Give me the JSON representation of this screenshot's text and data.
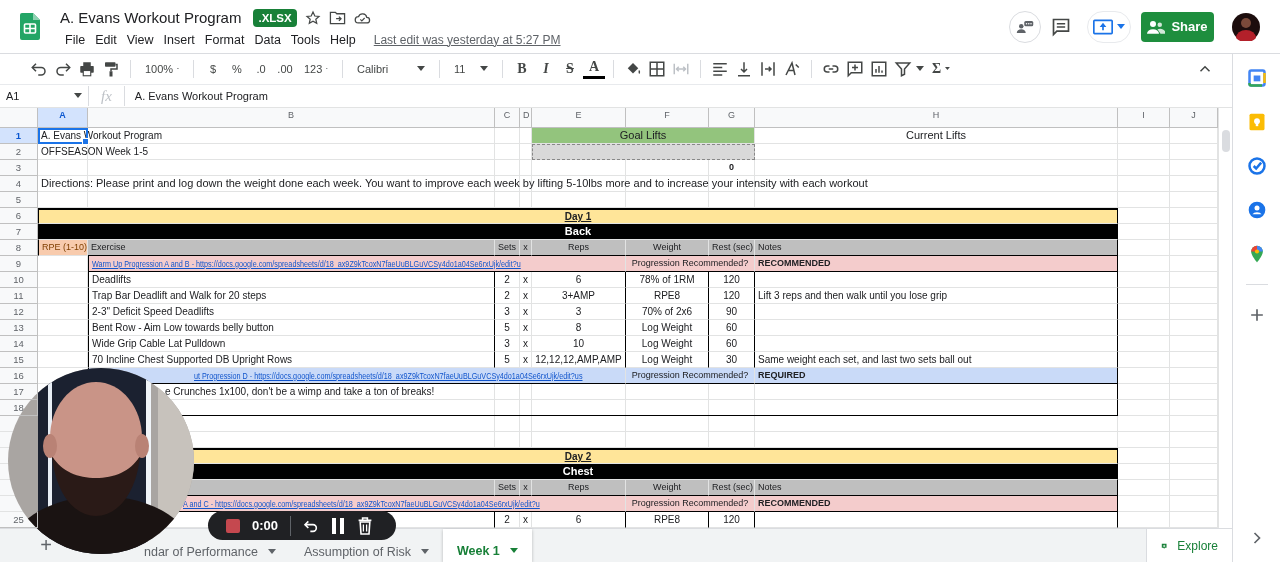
{
  "app": {
    "title": "A. Evans Workout Program",
    "badge": ".XLSX",
    "menu": [
      "File",
      "Edit",
      "View",
      "Insert",
      "Format",
      "Data",
      "Tools",
      "Help"
    ],
    "last_edit": "Last edit was yesterday at 5:27 PM",
    "share": "Share"
  },
  "toolbar": {
    "zoom": "100%",
    "currency": "$",
    "percent": "%",
    "decrease_decimals": ".0",
    "increase_decimals": ".00",
    "more_formats": "123",
    "font": "Calibri",
    "font_size": "11",
    "bold": "B",
    "italic": "I",
    "strikethrough": "S",
    "text_color": "A",
    "functions": "Σ"
  },
  "formula_bar": {
    "cell": "A1",
    "fx": "fx",
    "value": "A. Evans Workout Program"
  },
  "columns": [
    "A",
    "B",
    "C",
    "D",
    "E",
    "F",
    "G",
    "H",
    "I",
    "J"
  ],
  "rows": [
    {
      "number": "1",
      "selected": true,
      "kind": "title",
      "text": "A. Evans Workout Program",
      "goal": "Goal Lifts",
      "current": "Current Lifts"
    },
    {
      "number": "2",
      "selected": false,
      "kind": "subtitle",
      "text": "OFFSEASON Week 1-5"
    },
    {
      "number": "3",
      "selected": false,
      "kind": "total",
      "value": "0"
    },
    {
      "number": "4",
      "selected": false,
      "kind": "directions",
      "text": "Directions: Please print and log down the weight done each week. You want to improve each week by lifting 5-10lbs more and to increase your intensity with each workout"
    },
    {
      "number": "5",
      "selected": false,
      "kind": "blank"
    },
    {
      "number": "6",
      "selected": false,
      "kind": "day",
      "text": "Day 1"
    },
    {
      "number": "7",
      "selected": false,
      "kind": "section",
      "text": "Back"
    },
    {
      "number": "8",
      "selected": false,
      "kind": "header",
      "rpe": "RPE (1-10)",
      "exercise": "Exercise",
      "sets": "Sets",
      "x": "x",
      "reps": "Reps",
      "weight": "Weight",
      "rest": "Rest (sec)",
      "notes": "Notes"
    },
    {
      "number": "9",
      "selected": false,
      "kind": "link",
      "color": "#f4cccc",
      "link": "Warm Up Progression A and B - https://docs.google.com/spreadsheets/d/18_ax9Z9kTcoxN7faeUuBLGuVCSy4do1a04Se6rxUjk/edit?u",
      "question": "Progression Recommended?",
      "requirement": "RECOMMENDED"
    },
    {
      "number": "10",
      "selected": false,
      "kind": "exercise",
      "name": "Deadlifts",
      "sets": "2",
      "x": "x",
      "reps": "6",
      "weight": "78% of 1RM",
      "rest": "120"
    },
    {
      "number": "11",
      "selected": false,
      "kind": "exercise",
      "name": "Trap Bar Deadlift and Walk for 20 steps",
      "sets": "2",
      "x": "x",
      "reps": "3+AMP",
      "weight": "RPE8",
      "rest": "120",
      "notes": "Lift 3 reps and then walk until you lose grip"
    },
    {
      "number": "12",
      "selected": false,
      "kind": "exercise",
      "name": "2-3\" Deficit Speed Deadlifts",
      "sets": "3",
      "x": "x",
      "reps": "3",
      "weight": "70% of 2x6",
      "rest": "90"
    },
    {
      "number": "13",
      "selected": false,
      "kind": "exercise",
      "name": "Bent Row - Aim Low towards belly button",
      "sets": "5",
      "x": "x",
      "reps": "8",
      "weight": "Log Weight",
      "rest": "60"
    },
    {
      "number": "14",
      "selected": false,
      "kind": "exercise",
      "name": "Wide Grip Cable Lat Pulldown",
      "sets": "3",
      "x": "x",
      "reps": "10",
      "weight": "Log Weight",
      "rest": "60"
    },
    {
      "number": "15",
      "selected": false,
      "kind": "exercise",
      "name": "70 Incline Chest Supported DB Upright Rows",
      "sets": "5",
      "x": "x",
      "reps": "12,12,12,AMP,AMP",
      "weight": "Log Weight",
      "rest": "30",
      "notes": "Same weight each set, and last two sets ball out"
    },
    {
      "number": "16",
      "selected": false,
      "kind": "link",
      "color": "#c9daf8",
      "link": "ut Progression D - https://docs.google.com/spreadsheets/d/18_ax9Z9kTcoxN7faeUuBLGuVCSy4do1a04Se6rxUjk/edit?us",
      "question": "Progression Recommended?",
      "requirement": "REQUIRED"
    },
    {
      "number": "17",
      "selected": false,
      "kind": "note",
      "text": "e Crunches 1x100, don't be a wimp and take a ton of breaks!"
    },
    {
      "number": "18",
      "selected": false,
      "kind": "boxend"
    },
    {
      "kind": "blank"
    },
    {
      "kind": "blank"
    },
    {
      "kind": "day",
      "text": "Day 2"
    },
    {
      "kind": "section",
      "text": "Chest"
    },
    {
      "kind": "header",
      "sets": "Sets",
      "x": "x",
      "reps": "Reps",
      "weight": "Weight",
      "rest": "Rest (sec)",
      "notes": "Notes"
    },
    {
      "kind": "link",
      "color": "#f4cccc",
      "link": "A and C - https://docs.google.com/spreadsheets/d/18_ax9Z9kTcoxN7faeUuBLGuVCSy4do1a04Se6rxUjk/edit?u",
      "question": "Progression Recommended?",
      "requirement": "RECOMMENDED"
    },
    {
      "number": "25",
      "selected": false,
      "kind": "exercise",
      "sets": "2",
      "x": "x",
      "reps": "6",
      "weight": "RPE8",
      "rest": "120"
    }
  ],
  "add_sheet": "+",
  "sheet_tabs": [
    {
      "label": "ndar of Performance",
      "selected": false
    },
    {
      "label": "Assumption of Risk",
      "selected": false
    },
    {
      "label": "Week 1",
      "selected": true
    }
  ],
  "explore": "Explore",
  "recorder": {
    "time": "0:00"
  }
}
